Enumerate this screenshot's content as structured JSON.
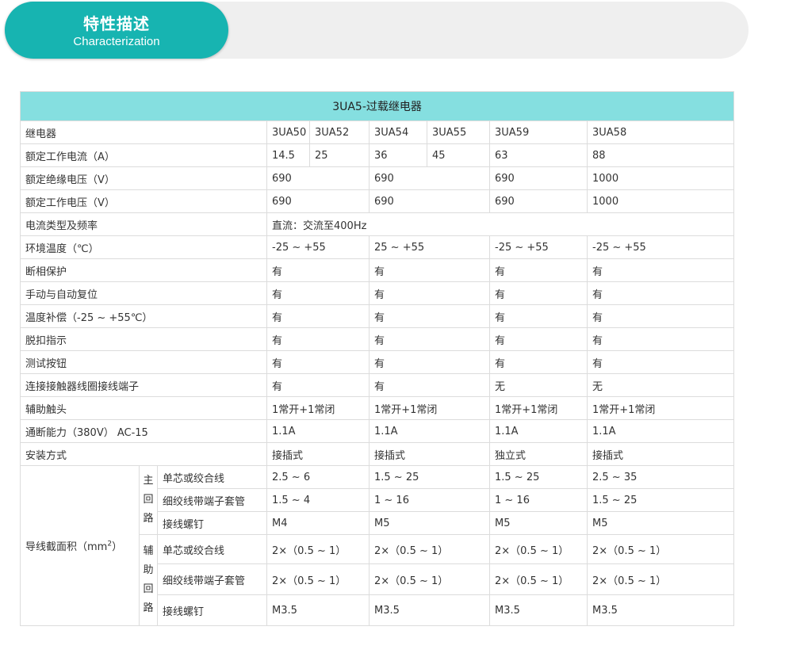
{
  "banner": {
    "title_cn": "特性描述",
    "title_en": "Characterization"
  },
  "table": {
    "title": "3UA5-过载继电器",
    "relay": {
      "label": "继电器",
      "models": [
        "3UA50",
        "3UA52",
        "3UA54",
        "3UA55",
        "3UA59",
        "3UA58"
      ]
    },
    "current": {
      "label": "额定工作电流（A）",
      "values": [
        "14.5",
        "25",
        "36",
        "45",
        "63",
        "88"
      ]
    },
    "insulation_voltage": {
      "label": "额定绝缘电压（V）",
      "values": [
        "690",
        "690",
        "690",
        "1000"
      ]
    },
    "operating_voltage": {
      "label": "额定工作电压（V）",
      "values": [
        "690",
        "690",
        "690",
        "1000"
      ]
    },
    "current_type": {
      "label": "电流类型及频率",
      "value": "直流：交流至400Hz"
    },
    "ambient": {
      "label": "环境温度（℃）",
      "values": [
        "-25 ~ +55",
        "25 ~ +55",
        "-25 ~ +55",
        "-25 ~ +55"
      ]
    },
    "phase_loss": {
      "label": "断相保护",
      "values": [
        "有",
        "有",
        "有",
        "有"
      ]
    },
    "reset": {
      "label": "手动与自动复位",
      "values": [
        "有",
        "有",
        "有",
        "有"
      ]
    },
    "temp_comp": {
      "label": "温度补偿（-25 ~ +55℃）",
      "values": [
        "有",
        "有",
        "有",
        "有"
      ]
    },
    "trip_indicator": {
      "label": "脱扣指示",
      "values": [
        "有",
        "有",
        "有",
        "有"
      ]
    },
    "test_button": {
      "label": "测试按钮",
      "values": [
        "有",
        "有",
        "有",
        "有"
      ]
    },
    "contactor_terminal": {
      "label": "连接接触器线圈接线端子",
      "values": [
        "有",
        "有",
        "无",
        "无"
      ]
    },
    "aux_contact": {
      "label": "辅助触头",
      "values": [
        "1常开+1常闭",
        "1常开+1常闭",
        "1常开+1常闭",
        "1常开+1常闭"
      ]
    },
    "breaking": {
      "label": "通断能力（380V） AC-15",
      "values": [
        "1.1A",
        "1.1A",
        "1.1A",
        "1.1A"
      ]
    },
    "mounting": {
      "label": "安装方式",
      "values": [
        "接插式",
        "接插式",
        "独立式",
        "接插式"
      ]
    },
    "cross_section": {
      "label_prefix": "导线截面积（mm",
      "label_sup": "2",
      "label_suffix": "）",
      "main_circuit": {
        "label_chars": [
          "主",
          "回",
          "路"
        ],
        "rows": [
          {
            "label": "单芯或绞合线",
            "values": [
              "2.5 ~ 6",
              "1.5 ~ 25",
              "1.5 ~ 25",
              "2.5 ~ 35"
            ]
          },
          {
            "label": "细绞线带端子套管",
            "values": [
              "1.5 ~ 4",
              "1 ~ 16",
              "1 ~ 16",
              "1.5 ~ 25"
            ]
          },
          {
            "label": "接线螺钉",
            "values": [
              "M4",
              "M5",
              "M5",
              "M5"
            ]
          }
        ]
      },
      "aux_circuit": {
        "label_chars": [
          "辅",
          "助",
          "回",
          "路"
        ],
        "rows": [
          {
            "label": "单芯或绞合线",
            "values": [
              "2×（0.5 ~ 1）",
              "2×（0.5 ~ 1）",
              "2×（0.5 ~ 1）",
              "2×（0.5 ~ 1）"
            ]
          },
          {
            "label": "细绞线带端子套管",
            "values": [
              "2×（0.5 ~ 1）",
              "2×（0.5 ~ 1）",
              "2×（0.5 ~ 1）",
              "2×（0.5 ~ 1）"
            ]
          },
          {
            "label": "接线螺钉",
            "values": [
              "M3.5",
              "M3.5",
              "M3.5",
              "M3.5"
            ]
          }
        ]
      }
    }
  }
}
